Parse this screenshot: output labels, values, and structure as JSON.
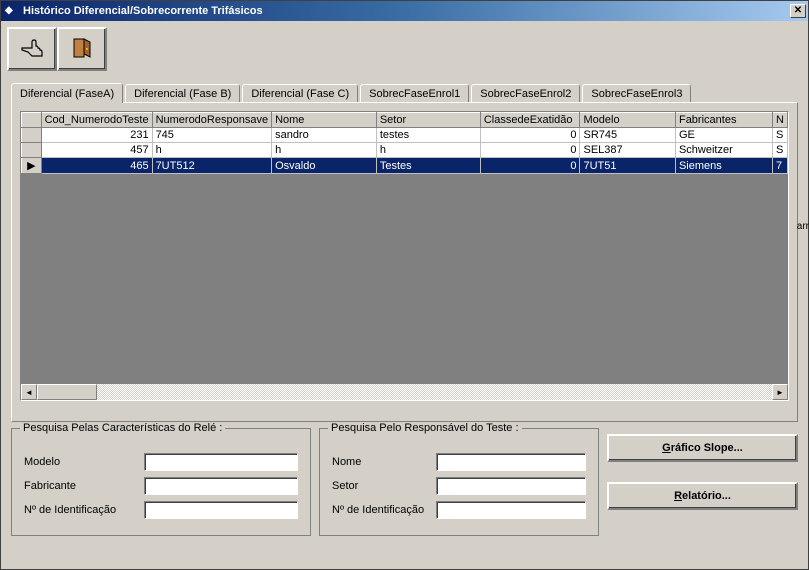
{
  "window": {
    "title": "Histórico Diferencial/Sobrecorrente Trifásicos"
  },
  "tabs": [
    {
      "label": "Diferencial (FaseA)"
    },
    {
      "label": "Diferencial (Fase B)"
    },
    {
      "label": "Diferencial (Fase C)"
    },
    {
      "label": "SobrecFaseEnrol1"
    },
    {
      "label": "SobrecFaseEnrol2"
    },
    {
      "label": "SobrecFaseEnrol3"
    }
  ],
  "grid": {
    "columns": [
      "Cod_NumerodoTeste",
      "NumerodoResponsave",
      "Nome",
      "Setor",
      "ClassedeExatidão",
      "Modelo",
      "Fabricantes",
      "N"
    ],
    "rows": [
      {
        "cod": "231",
        "resp": "745",
        "nome": "sandro",
        "setor": "testes",
        "classe": "0",
        "modelo": "SR745",
        "fabricante": "GE",
        "n": "S"
      },
      {
        "cod": "457",
        "resp": "h",
        "nome": "h",
        "setor": "h",
        "classe": "0",
        "modelo": "SEL387",
        "fabricante": "Schweitzer",
        "n": "S"
      },
      {
        "cod": "465",
        "resp": "7UT512",
        "nome": "Osvaldo",
        "setor": "Testes",
        "classe": "0",
        "modelo": "7UT51",
        "fabricante": "Siemens",
        "n": "7"
      }
    ]
  },
  "search_rele": {
    "legend": "Pesquisa Pelas Características do Relé :",
    "modelo_label": "Modelo",
    "fabricante_label": "Fabricante",
    "ident_label": "Nº de Identificação",
    "modelo_value": "",
    "fabricante_value": "",
    "ident_value": ""
  },
  "search_resp": {
    "legend": "Pesquisa Pelo Responsável do Teste :",
    "nome_label": "Nome",
    "setor_label": "Setor",
    "ident_label": "Nº de Identificação",
    "nome_value": "",
    "setor_value": "",
    "ident_value": ""
  },
  "buttons": {
    "grafico_prefix": "G",
    "grafico_suffix": "ráfico Slope...",
    "relatorio_prefix": "R",
    "relatorio_suffix": "elatório..."
  },
  "stray_text": "arr"
}
